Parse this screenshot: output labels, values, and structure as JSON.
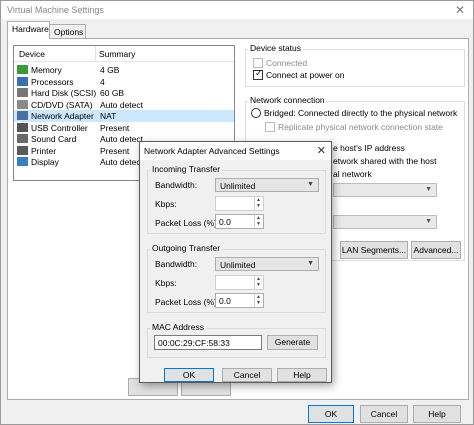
{
  "window": {
    "title": "Virtual Machine Settings"
  },
  "tabs": [
    {
      "label": "Hardware"
    },
    {
      "label": "Options"
    }
  ],
  "devices": {
    "col_device": "Device",
    "col_summary": "Summary",
    "rows": [
      {
        "name": "Memory",
        "summary": "4 GB",
        "icon": "memory-icon",
        "color": "#3a9a3a"
      },
      {
        "name": "Processors",
        "summary": "4",
        "icon": "processor-icon",
        "color": "#3a6fb0"
      },
      {
        "name": "Hard Disk (SCSI)",
        "summary": "60 GB",
        "icon": "hard-disk-icon",
        "color": "#777777"
      },
      {
        "name": "CD/DVD (SATA)",
        "summary": "Auto detect",
        "icon": "cd-dvd-icon",
        "color": "#8a8a8a"
      },
      {
        "name": "Network Adapter",
        "summary": "NAT",
        "icon": "network-adapter-icon",
        "color": "#4a6fa0"
      },
      {
        "name": "USB Controller",
        "summary": "Present",
        "icon": "usb-icon",
        "color": "#555555"
      },
      {
        "name": "Sound Card",
        "summary": "Auto detect",
        "icon": "sound-card-icon",
        "color": "#6a6a6a"
      },
      {
        "name": "Printer",
        "summary": "Present",
        "icon": "printer-icon",
        "color": "#5a5a5a"
      },
      {
        "name": "Display",
        "summary": "Auto detect",
        "icon": "display-icon",
        "color": "#3a7fc0"
      }
    ]
  },
  "device_status": {
    "label": "Device status",
    "connected": "Connected",
    "connect_at_power_on": "Connect at power on"
  },
  "network_connection": {
    "label": "Network connection",
    "bridged": "Bridged: Connected directly to the physical network",
    "replicate": "Replicate physical network connection state",
    "host_ip": "e host's IP address",
    "nat_shared": "etwork shared with the host",
    "private": "al network"
  },
  "buttons": {
    "lan_segments": "LAN Segments...",
    "advanced": "Advanced...",
    "ok": "OK",
    "cancel": "Cancel",
    "help": "Help"
  },
  "dialog": {
    "title": "Network Adapter Advanced Settings",
    "incoming": {
      "label": "Incoming Transfer",
      "bandwidth_label": "Bandwidth:",
      "bandwidth_value": "Unlimited",
      "kbps_label": "Kbps:",
      "packet_loss_label": "Packet Loss (%):",
      "packet_loss_value": "0.0"
    },
    "outgoing": {
      "label": "Outgoing Transfer",
      "bandwidth_label": "Bandwidth:",
      "bandwidth_value": "Unlimited",
      "kbps_label": "Kbps:",
      "packet_loss_label": "Packet Loss (%):",
      "packet_loss_value": "0.0"
    },
    "mac": {
      "label": "MAC Address",
      "value": "00:0C:29:CF:58:33",
      "generate": "Generate"
    },
    "ok": "OK",
    "cancel": "Cancel",
    "help": "Help"
  }
}
